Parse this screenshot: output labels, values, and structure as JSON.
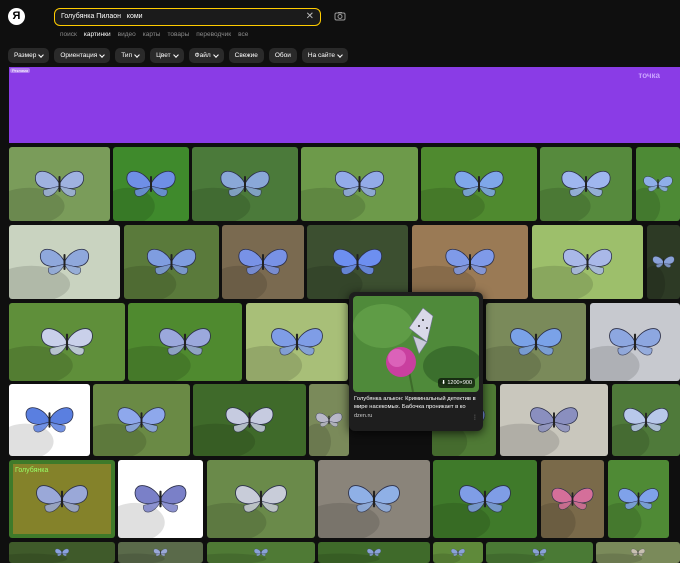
{
  "header": {
    "logo": "Я",
    "search_query": "Голубянка Пилаон   коми",
    "tabs": [
      {
        "label": "поиск",
        "active": false
      },
      {
        "label": "картинки",
        "active": true
      },
      {
        "label": "видео",
        "active": false
      },
      {
        "label": "карты",
        "active": false
      },
      {
        "label": "товары",
        "active": false
      },
      {
        "label": "переводчик",
        "active": false
      },
      {
        "label": "все",
        "active": false
      }
    ]
  },
  "filters": [
    {
      "label": "Размер",
      "dropdown": true
    },
    {
      "label": "Ориентация",
      "dropdown": true
    },
    {
      "label": "Тип",
      "dropdown": true
    },
    {
      "label": "Цвет",
      "dropdown": true
    },
    {
      "label": "Файл",
      "dropdown": true
    },
    {
      "label": "Свежие",
      "dropdown": false
    },
    {
      "label": "Обои",
      "dropdown": false
    },
    {
      "label": "На сайте",
      "dropdown": true
    }
  ],
  "ad": {
    "badge": "Реклама",
    "brand": "точка",
    "color": "#8a3ce6"
  },
  "popup": {
    "resolution": "1200×900",
    "title": "Голубянка алькон: Криминальный детектив в мире насекомых. Бабочка проникает в ко",
    "source": "dzen.ru"
  },
  "collage": {
    "title": "Голубянка"
  }
}
